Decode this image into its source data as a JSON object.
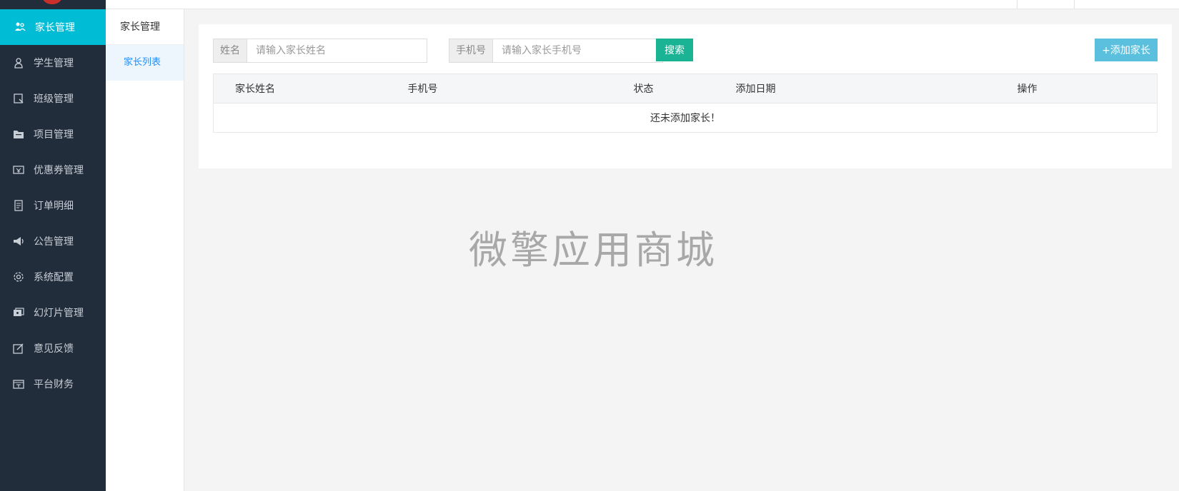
{
  "sidebar": {
    "items": [
      {
        "label": "家长管理",
        "icon": "parents-icon",
        "active": true
      },
      {
        "label": "学生管理",
        "icon": "user-icon",
        "active": false
      },
      {
        "label": "班级管理",
        "icon": "class-icon",
        "active": false
      },
      {
        "label": "项目管理",
        "icon": "folder-icon",
        "active": false
      },
      {
        "label": "优惠券管理",
        "icon": "coupon-icon",
        "active": false
      },
      {
        "label": "订单明细",
        "icon": "order-icon",
        "active": false
      },
      {
        "label": "公告管理",
        "icon": "megaphone-icon",
        "active": false
      },
      {
        "label": "系统配置",
        "icon": "gear-icon",
        "active": false
      },
      {
        "label": "幻灯片管理",
        "icon": "slides-icon",
        "active": false
      },
      {
        "label": "意见反馈",
        "icon": "feedback-icon",
        "active": false
      },
      {
        "label": "平台财务",
        "icon": "finance-icon",
        "active": false
      }
    ]
  },
  "subnav": {
    "title": "家长管理",
    "items": [
      {
        "label": "家长列表",
        "active": true
      }
    ]
  },
  "search": {
    "name_addon": "姓名",
    "name_placeholder": "请输入家长姓名",
    "phone_addon": "手机号",
    "phone_placeholder": "请输入家长手机号",
    "search_button": "搜索",
    "add_button": "+添加家长"
  },
  "table": {
    "headers": [
      "家长姓名",
      "手机号",
      "状态",
      "添加日期",
      "操作"
    ],
    "empty_text": "还未添加家长！"
  },
  "watermark": "微擎应用商城",
  "colors": {
    "sidebar_bg": "#222d3b",
    "active_item": "#00bcd4",
    "search_button": "#1ab394",
    "add_button": "#5bc0de"
  }
}
